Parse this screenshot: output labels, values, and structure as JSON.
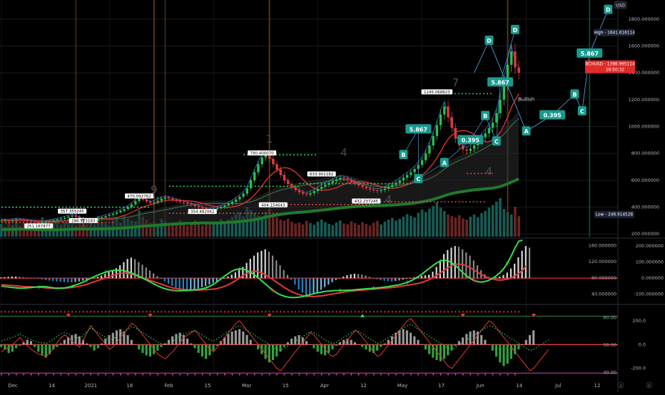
{
  "currency_label": "USD",
  "chart_data": [
    {
      "type": "candlestick",
      "symbol": "BCHUSD",
      "price_axis": {
        "range": [
          180,
          1900
        ],
        "ticks": [
          200,
          400,
          600,
          800,
          1000,
          1200,
          1400,
          1600,
          1800
        ],
        "tick_labels": [
          "200.000000",
          "400.000000",
          "600.000000",
          "800.000000",
          "1000.000000",
          "1200.000000",
          "1400.000000",
          "1600.000000",
          "1800.000000"
        ]
      },
      "time_axis": {
        "labels": [
          "Dec",
          "14",
          "2021",
          "18",
          "Feb",
          "15",
          "Mar",
          "15",
          "Apr",
          "12",
          "May",
          "17",
          "Jun",
          "14",
          "Jul",
          "12"
        ],
        "bottom_icons": [
          "A",
          "B"
        ]
      },
      "high_label": "High",
      "high_value": "1641.616114",
      "high": 1641.616114,
      "current_label": "BCHUSD",
      "current_value": "1398.995114",
      "current": 1398.995114,
      "countdown": "18:50:32",
      "low_label": "Low",
      "low_value": "246.914528",
      "low": 246.914528,
      "wave_labels": [
        "A",
        "B",
        "C",
        "D",
        "0.395",
        "5.867"
      ],
      "wave_points": [
        {
          "label": "D",
          "date_index": 131,
          "price": 1640
        },
        {
          "label": "A",
          "date_index": 141,
          "price": 965
        },
        {
          "label": "0.395",
          "date_index": 148,
          "price": 1085
        },
        {
          "label": "B",
          "date_index": 154,
          "price": 1240
        },
        {
          "label": "C",
          "date_index": 156,
          "price": 1115
        },
        {
          "label": "5.867",
          "date_index": 158,
          "price": 1545
        },
        {
          "label": "D",
          "date_index": 163,
          "price": 1870
        }
      ],
      "price_callouts": [
        {
          "text": "251.167877",
          "date_index": 10,
          "price": 246.9
        },
        {
          "text": "357.355245",
          "date_index": 19,
          "price": 357.4
        },
        {
          "text": "286.573183",
          "date_index": 22,
          "price": 286.6
        },
        {
          "text": "470.092762",
          "date_index": 37,
          "price": 470.1
        },
        {
          "text": "354.482062",
          "date_index": 54,
          "price": 354.5
        },
        {
          "text": "790.400070",
          "date_index": 70,
          "price": 790.4
        },
        {
          "text": "404.154643",
          "date_index": 73,
          "price": 404.2
        },
        {
          "text": "633.901182",
          "date_index": 86,
          "price": 633.9
        },
        {
          "text": "432.237245",
          "date_index": 98,
          "price": 432.2
        },
        {
          "text": "1245.068823",
          "date_index": 117,
          "price": 1245.1
        }
      ],
      "notes": [
        "Bullish"
      ],
      "count_numbers": [
        "1",
        "9",
        "1",
        "4",
        "4",
        "7",
        "4"
      ],
      "wave_tags": [
        {
          "label": "B",
          "date_index": 108,
          "price": 790
        },
        {
          "label": "5.867",
          "date_index": 112,
          "price": 980
        },
        {
          "label": "C",
          "date_index": 112,
          "price": 610
        },
        {
          "label": "A",
          "date_index": 119,
          "price": 730
        },
        {
          "label": "0.395",
          "date_index": 126,
          "price": 900
        },
        {
          "label": "B",
          "date_index": 130,
          "price": 1080
        },
        {
          "label": "C",
          "date_index": 133,
          "price": 890
        },
        {
          "label": "5.867",
          "date_index": 134,
          "price": 1330
        },
        {
          "label": "D",
          "date_index": 138,
          "price": 1720
        }
      ],
      "closes": [
        300,
        302,
        298,
        304,
        310,
        306,
        301,
        297,
        292,
        288,
        280,
        285,
        291,
        296,
        303,
        309,
        315,
        322,
        330,
        337,
        329,
        318,
        305,
        295,
        300,
        307,
        316,
        325,
        334,
        342,
        350,
        361,
        373,
        386,
        400,
        421,
        445,
        470,
        456,
        442,
        430,
        436,
        448,
        462,
        470,
        464,
        455,
        447,
        440,
        433,
        425,
        417,
        408,
        400,
        392,
        386,
        380,
        385,
        393,
        402,
        412,
        425,
        440,
        458,
        478,
        500,
        540,
        600,
        660,
        720,
        770,
        790,
        760,
        720,
        680,
        640,
        600,
        572,
        548,
        528,
        512,
        500,
        494,
        505,
        520,
        536,
        552,
        566,
        580,
        594,
        606,
        618,
        612,
        602,
        590,
        576,
        562,
        550,
        540,
        532,
        525,
        520,
        528,
        538,
        552,
        566,
        582,
        600,
        620,
        640,
        660,
        685,
        715,
        750,
        800,
        860,
        930,
        1010,
        1090,
        1150,
        1070,
        990,
        910,
        860,
        830,
        820,
        835,
        860,
        890,
        920,
        950,
        990,
        1030,
        1100,
        1200,
        1320,
        1460,
        1560,
        1440,
        1400
      ],
      "volume_range": [
        0,
        100
      ],
      "volumes": [
        30,
        22,
        35,
        28,
        40,
        26,
        33,
        25,
        38,
        30,
        27,
        45,
        32,
        29,
        36,
        41,
        28,
        34,
        39,
        31,
        26,
        43,
        37,
        30,
        34,
        29,
        48,
        35,
        31,
        27,
        39,
        44,
        33,
        50,
        42,
        38,
        36,
        61,
        47,
        40,
        33,
        35,
        30,
        42,
        37,
        31,
        28,
        34,
        39,
        29,
        26,
        33,
        38,
        30,
        27,
        36,
        31,
        29,
        34,
        41,
        35,
        40,
        46,
        52,
        57,
        48,
        70,
        62,
        55,
        49,
        44,
        58,
        66,
        51,
        46,
        40,
        38,
        42,
        35,
        31,
        33,
        29,
        37,
        32,
        28,
        35,
        40,
        34,
        30,
        27,
        33,
        38,
        31,
        29,
        36,
        32,
        28,
        34,
        30,
        26,
        33,
        37,
        29,
        35,
        40,
        44,
        38,
        42,
        47,
        53,
        49,
        45,
        56,
        63,
        58,
        66,
        72,
        80,
        68,
        60,
        52,
        48,
        45,
        50,
        43,
        40,
        47,
        52,
        46,
        55,
        60,
        68,
        74,
        82,
        90,
        65,
        58,
        52,
        70,
        48
      ]
    },
    {
      "type": "histogram+line",
      "name": "MACD",
      "ticks_left": [
        40,
        80,
        120,
        160
      ],
      "tick_labels_left": [
        "40.000000",
        "80.000000",
        "120.000000",
        "160.000000"
      ],
      "ticks_right": [
        -100,
        0,
        100,
        200
      ],
      "tick_labels_right": [
        "-100.000000",
        "0.000000",
        "100.000000",
        "200.000000"
      ],
      "range": [
        -150,
        240
      ],
      "histogram": [
        5,
        6,
        8,
        10,
        10,
        8,
        6,
        4,
        2,
        -2,
        -5,
        -8,
        -12,
        -15,
        -18,
        -20,
        -22,
        -24,
        -25,
        -26,
        -24,
        -20,
        -16,
        -10,
        -5,
        0,
        8,
        16,
        26,
        38,
        50,
        62,
        80,
        100,
        120,
        128,
        118,
        100,
        84,
        66,
        48,
        30,
        12,
        -5,
        -20,
        -34,
        -48,
        -60,
        -70,
        -80,
        -82,
        -78,
        -72,
        -64,
        -56,
        -48,
        -40,
        -30,
        -20,
        -10,
        0,
        10,
        22,
        36,
        52,
        70,
        95,
        120,
        140,
        160,
        170,
        180,
        165,
        140,
        110,
        80,
        50,
        20,
        -10,
        -40,
        -70,
        -90,
        -105,
        -110,
        -100,
        -88,
        -72,
        -55,
        -40,
        -25,
        -12,
        0,
        10,
        18,
        24,
        28,
        26,
        22,
        16,
        8,
        0,
        -6,
        -12,
        -16,
        -18,
        -20,
        -17,
        -14,
        -10,
        -5,
        0,
        5,
        10,
        14,
        18,
        22,
        40,
        70,
        110,
        150,
        175,
        190,
        200,
        195,
        180,
        160,
        140,
        110,
        80,
        50,
        25,
        8,
        0,
        5,
        10,
        20,
        35,
        60,
        90,
        130,
        170,
        200,
        190
      ],
      "signal": [
        -40,
        -42,
        -44,
        -46,
        -48,
        -50,
        -52,
        -53,
        -54,
        -55,
        -56,
        -58,
        -60,
        -62,
        -63,
        -64,
        -63,
        -62,
        -60,
        -57,
        -54,
        -50,
        -44,
        -38,
        -30,
        -22,
        -14,
        -6,
        2,
        10,
        18,
        25,
        30,
        32,
        30,
        25,
        18,
        10,
        2,
        -6,
        -14,
        -22,
        -30,
        -38,
        -46,
        -54,
        -60,
        -65,
        -68,
        -70,
        -72,
        -73,
        -74,
        -74,
        -73,
        -72,
        -70,
        -68,
        -64,
        -58,
        -50,
        -40,
        -28,
        -14,
        2,
        18,
        30,
        40,
        44,
        40,
        32,
        20,
        6,
        -10,
        -26,
        -42,
        -58,
        -72,
        -84,
        -94,
        -102,
        -108,
        -112,
        -114,
        -114,
        -112,
        -110,
        -106,
        -102,
        -98,
        -94,
        -90,
        -86,
        -82,
        -80,
        -78,
        -76,
        -74,
        -72,
        -70,
        -68,
        -66,
        -64,
        -62,
        -60,
        -58,
        -55,
        -52,
        -48,
        -44,
        -40,
        -36,
        -32,
        -26,
        -18,
        -8,
        4,
        18,
        34,
        50,
        66,
        78,
        86,
        88,
        84,
        76,
        64,
        50,
        36,
        22,
        10,
        0,
        -6,
        -10,
        -12,
        -10,
        -6,
        2,
        14,
        30,
        50,
        76
      ],
      "macd": [
        -50,
        -52,
        -55,
        -58,
        -60,
        -62,
        -62,
        -60,
        -58,
        -56,
        -54,
        -52,
        -54,
        -57,
        -60,
        -62,
        -62,
        -60,
        -56,
        -50,
        -42,
        -34,
        -24,
        -12,
        0,
        10,
        20,
        30,
        38,
        44,
        48,
        50,
        50,
        46,
        40,
        32,
        22,
        12,
        0,
        -12,
        -24,
        -36,
        -48,
        -58,
        -66,
        -72,
        -76,
        -78,
        -78,
        -77,
        -76,
        -74,
        -72,
        -70,
        -66,
        -60,
        -50,
        -38,
        -22,
        -4,
        14,
        30,
        44,
        54,
        58,
        56,
        48,
        36,
        20,
        2,
        -18,
        -38,
        -58,
        -76,
        -92,
        -104,
        -112,
        -118,
        -120,
        -120,
        -118,
        -114,
        -108,
        -102,
        -96,
        -90,
        -86,
        -82,
        -80,
        -78,
        -77,
        -76,
        -76,
        -75,
        -74,
        -72,
        -70,
        -68,
        -66,
        -64,
        -62,
        -60,
        -58,
        -55,
        -52,
        -48,
        -44,
        -40,
        -34,
        -26,
        -16,
        -4,
        10,
        26,
        44,
        62,
        80,
        96,
        108,
        112,
        108,
        96,
        78,
        56,
        34,
        14,
        -2,
        -14,
        -22,
        -24,
        -20,
        -12,
        0,
        16,
        36,
        62,
        96,
        140,
        190,
        230,
        236
      ]
    },
    {
      "type": "histogram+line",
      "name": "oscillator",
      "ticks_left": [
        40,
        50,
        60
      ],
      "tick_labels_left": [
        "40.00",
        "50.00",
        "60.00"
      ],
      "ticks_right": [
        -200,
        0,
        200
      ],
      "tick_labels_right": [
        "-200.0",
        "0.0",
        "200.0"
      ],
      "range": [
        -280,
        320
      ],
      "histogram": [
        -20,
        -40,
        -70,
        -60,
        -30,
        -10,
        20,
        40,
        30,
        -20,
        -60,
        -90,
        -110,
        -80,
        -40,
        -20,
        10,
        40,
        60,
        80,
        90,
        70,
        40,
        10,
        -20,
        -50,
        -30,
        10,
        50,
        80,
        100,
        120,
        130,
        110,
        80,
        40,
        0,
        -40,
        -70,
        -90,
        -100,
        -80,
        -50,
        -20,
        10,
        40,
        70,
        90,
        100,
        80,
        50,
        10,
        -30,
        -70,
        -100,
        -120,
        -90,
        -50,
        -10,
        30,
        60,
        90,
        110,
        120,
        130,
        110,
        80,
        40,
        0,
        -40,
        -80,
        -120,
        -150,
        -130,
        -100,
        -60,
        -20,
        20,
        50,
        70,
        80,
        60,
        30,
        0,
        -30,
        -60,
        -80,
        -90,
        -70,
        -40,
        -10,
        20,
        40,
        50,
        40,
        20,
        0,
        -20,
        -40,
        -60,
        -70,
        -50,
        -20,
        10,
        40,
        70,
        100,
        120,
        130,
        120,
        100,
        70,
        40,
        0,
        -40,
        -80,
        -110,
        -130,
        -140,
        -120,
        -90,
        -50,
        -10,
        30,
        60,
        90,
        110,
        120,
        110,
        80,
        40,
        0,
        -50,
        -100,
        -150,
        -180,
        -160,
        -120,
        -80,
        -40,
        0,
        40,
        80,
        120
      ],
      "line": [
        -60,
        -40,
        -20,
        0,
        30,
        60,
        20,
        -10,
        -40,
        -60,
        -80,
        -90,
        -100,
        -70,
        -30,
        20,
        60,
        80,
        60,
        30,
        0,
        -20,
        40,
        100,
        160,
        120,
        80,
        40,
        0,
        -40,
        -20,
        20,
        60,
        100,
        140,
        180,
        160,
        120,
        80,
        40,
        0,
        -40,
        -80,
        -100,
        -120,
        -90,
        -60,
        -20,
        20,
        60,
        80,
        100,
        120,
        80,
        40,
        0,
        -40,
        -60,
        -20,
        20,
        60,
        100,
        140,
        180,
        200,
        160,
        120,
        80,
        40,
        0,
        -40,
        -80,
        -120,
        -160,
        -200,
        -220,
        -180,
        -140,
        -100,
        -60,
        -20,
        20,
        60,
        100,
        80,
        40,
        0,
        -40,
        -80,
        -100,
        -80,
        -40,
        0,
        40,
        80,
        120,
        100,
        60,
        20,
        -20,
        -60,
        -100,
        -80,
        -40,
        0,
        40,
        80,
        120,
        160,
        200,
        220,
        180,
        140,
        100,
        60,
        20,
        -20,
        -60,
        -100,
        -140,
        -180,
        -200,
        -160,
        -120,
        -80,
        -40,
        0,
        40,
        80,
        120,
        160,
        200,
        180,
        140,
        100,
        60,
        20,
        -20,
        -60,
        -100,
        -140,
        -180,
        -220,
        -200,
        -160,
        -120,
        -80,
        -40
      ]
    }
  ]
}
